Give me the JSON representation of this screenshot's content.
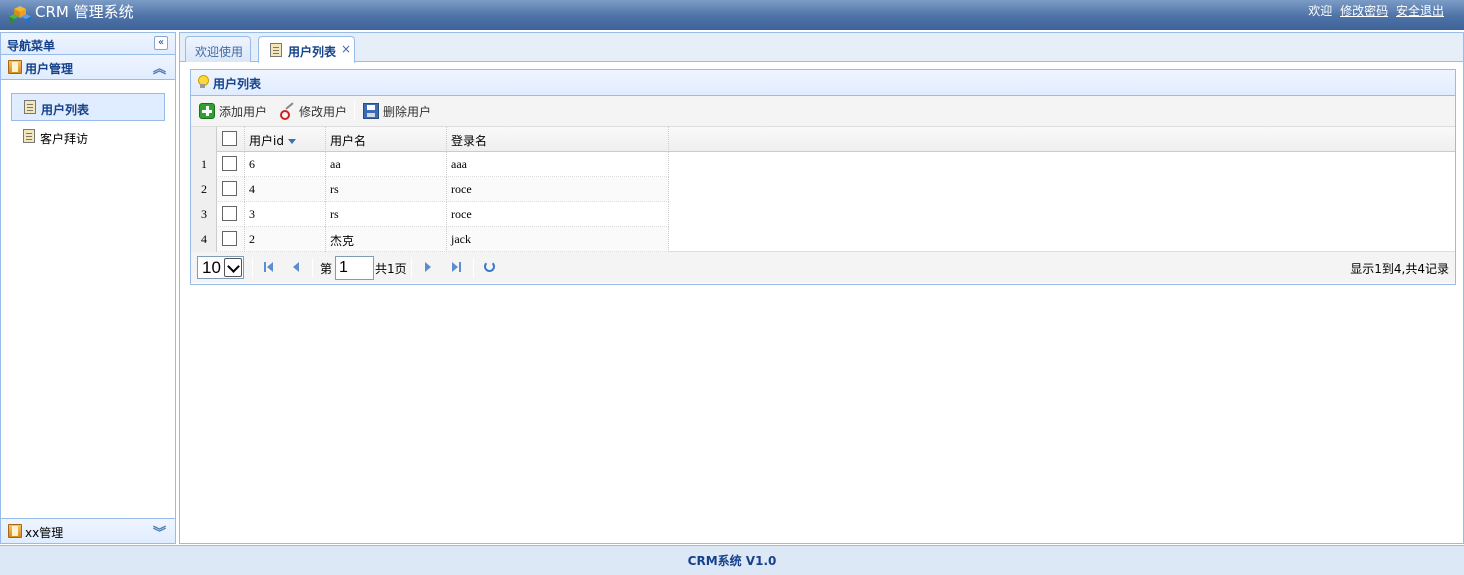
{
  "header": {
    "title": "CRM 管理系统",
    "welcome": "欢迎",
    "change_password": "修改密码",
    "logout": "安全退出"
  },
  "sidebar": {
    "title": "导航菜单",
    "collapse_icon": "double-chevron-left-icon",
    "groups": [
      {
        "label": "用户管理",
        "expanded": true,
        "items": [
          {
            "label": "用户列表",
            "selected": true
          },
          {
            "label": "客户拜访",
            "selected": false
          }
        ]
      },
      {
        "label": "xx管理",
        "expanded": false,
        "items": []
      }
    ]
  },
  "tabs": [
    {
      "label": "欢迎使用",
      "active": false,
      "closable": false
    },
    {
      "label": "用户列表",
      "active": true,
      "closable": true,
      "close": "×"
    }
  ],
  "panel": {
    "title": "用户列表",
    "toolbar": {
      "add": "添加用户",
      "edit": "修改用户",
      "delete": "删除用户"
    },
    "grid": {
      "columns": [
        "用户id",
        "用户名",
        "登录名"
      ],
      "sorted_column": "用户id",
      "rows": [
        {
          "num": "1",
          "id": "6",
          "name": "aa",
          "login": "aaa"
        },
        {
          "num": "2",
          "id": "4",
          "name": "rs",
          "login": "roce"
        },
        {
          "num": "3",
          "id": "3",
          "name": "rs",
          "login": "roce"
        },
        {
          "num": "4",
          "id": "2",
          "name": "杰克",
          "login": "jack"
        }
      ]
    },
    "pager": {
      "page_size": "10",
      "page_prefix": "第",
      "page_number": "1",
      "page_total": "共1页",
      "info": "显示1到4,共4记录"
    }
  },
  "footer": {
    "text": "CRM系统 V1.0"
  },
  "colors": {
    "header": "#4e72a6",
    "border": "#99bbe8",
    "title": "#15428b"
  }
}
